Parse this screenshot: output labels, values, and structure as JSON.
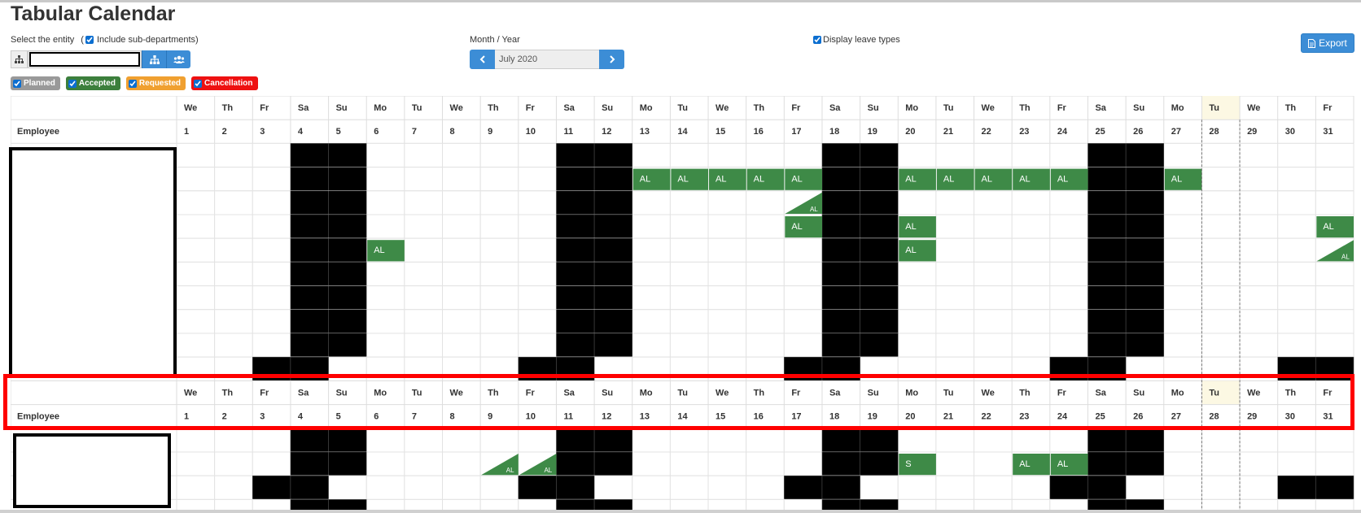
{
  "page": {
    "title": "Tabular Calendar"
  },
  "filters": {
    "entity_label": "Select the entity",
    "include_open_paren": "(",
    "include_sub_label": "Include sub-departments)",
    "include_sub_checked": true,
    "entity_value": "",
    "month_label": "Month / Year",
    "month_value": "July 2020",
    "display_leave_types_label": "Display leave types",
    "display_leave_types_checked": true,
    "export_label": "Export"
  },
  "legend": [
    {
      "label": "Planned",
      "color": "#999999"
    },
    {
      "label": "Accepted",
      "color": "#3c7f3c"
    },
    {
      "label": "Requested",
      "color": "#f0a030"
    },
    {
      "label": "Cancellation",
      "color": "#ee1111"
    }
  ],
  "colors": {
    "leave": "#3e8a47",
    "weekend": "#000000",
    "today_header": "#fcf8e3",
    "highlight": "#ff0000"
  },
  "calendar": {
    "employee_header": "Employee",
    "today_day": 28,
    "days": [
      {
        "d": 1,
        "w": "We"
      },
      {
        "d": 2,
        "w": "Th"
      },
      {
        "d": 3,
        "w": "Fr"
      },
      {
        "d": 4,
        "w": "Sa"
      },
      {
        "d": 5,
        "w": "Su"
      },
      {
        "d": 6,
        "w": "Mo"
      },
      {
        "d": 7,
        "w": "Tu"
      },
      {
        "d": 8,
        "w": "We"
      },
      {
        "d": 9,
        "w": "Th"
      },
      {
        "d": 10,
        "w": "Fr"
      },
      {
        "d": 11,
        "w": "Sa"
      },
      {
        "d": 12,
        "w": "Su"
      },
      {
        "d": 13,
        "w": "Mo"
      },
      {
        "d": 14,
        "w": "Tu"
      },
      {
        "d": 15,
        "w": "We"
      },
      {
        "d": 16,
        "w": "Th"
      },
      {
        "d": 17,
        "w": "Fr"
      },
      {
        "d": 18,
        "w": "Sa"
      },
      {
        "d": 19,
        "w": "Su"
      },
      {
        "d": 20,
        "w": "Mo"
      },
      {
        "d": 21,
        "w": "Tu"
      },
      {
        "d": 22,
        "w": "We"
      },
      {
        "d": 23,
        "w": "Th"
      },
      {
        "d": 24,
        "w": "Fr"
      },
      {
        "d": 25,
        "w": "Sa"
      },
      {
        "d": 26,
        "w": "Su"
      },
      {
        "d": 27,
        "w": "Mo"
      },
      {
        "d": 28,
        "w": "Tu"
      },
      {
        "d": 29,
        "w": "We"
      },
      {
        "d": 30,
        "w": "Th"
      },
      {
        "d": 31,
        "w": "Fr"
      }
    ],
    "groups": [
      {
        "employee_name": "",
        "rows": [
          {
            "blocked": [
              4,
              5,
              11,
              12,
              18,
              19,
              25,
              26
            ],
            "leaves": []
          },
          {
            "blocked": [
              4,
              5,
              11,
              12,
              18,
              19,
              25,
              26
            ],
            "leaves": [
              {
                "day": 13,
                "code": "AL"
              },
              {
                "day": 14,
                "code": "AL"
              },
              {
                "day": 15,
                "code": "AL"
              },
              {
                "day": 16,
                "code": "AL"
              },
              {
                "day": 17,
                "code": "AL"
              },
              {
                "day": 20,
                "code": "AL"
              },
              {
                "day": 21,
                "code": "AL"
              },
              {
                "day": 22,
                "code": "AL"
              },
              {
                "day": 23,
                "code": "AL"
              },
              {
                "day": 24,
                "code": "AL"
              },
              {
                "day": 27,
                "code": "AL"
              }
            ]
          },
          {
            "blocked": [
              4,
              5,
              11,
              12,
              18,
              19,
              25,
              26
            ],
            "leaves": [
              {
                "day": 17,
                "code": "AL",
                "half": true
              }
            ]
          },
          {
            "blocked": [
              4,
              5,
              11,
              12,
              18,
              19,
              25,
              26
            ],
            "leaves": [
              {
                "day": 17,
                "code": "AL"
              },
              {
                "day": 20,
                "code": "AL"
              },
              {
                "day": 31,
                "code": "AL"
              }
            ]
          },
          {
            "blocked": [
              4,
              5,
              11,
              12,
              18,
              19,
              25,
              26
            ],
            "leaves": [
              {
                "day": 6,
                "code": "AL"
              },
              {
                "day": 20,
                "code": "AL"
              },
              {
                "day": 31,
                "code": "AL",
                "half": true
              }
            ]
          },
          {
            "blocked": [
              4,
              5,
              11,
              12,
              18,
              19,
              25,
              26
            ],
            "leaves": []
          },
          {
            "blocked": [
              4,
              5,
              11,
              12,
              18,
              19,
              25,
              26
            ],
            "leaves": []
          },
          {
            "blocked": [
              4,
              5,
              11,
              12,
              18,
              19,
              25,
              26
            ],
            "leaves": []
          },
          {
            "blocked": [
              4,
              5,
              11,
              12,
              18,
              19,
              25,
              26
            ],
            "leaves": []
          },
          {
            "blocked": [
              3,
              4,
              10,
              11,
              17,
              18,
              24,
              25,
              30,
              31
            ],
            "leaves": []
          }
        ]
      },
      {
        "employee_name": "",
        "rows": [
          {
            "blocked": [
              4,
              5,
              11,
              12,
              18,
              19,
              25,
              26
            ],
            "leaves": []
          },
          {
            "blocked": [
              4,
              5,
              11,
              12,
              18,
              19,
              25,
              26
            ],
            "leaves": [
              {
                "day": 9,
                "code": "AL",
                "half": true
              },
              {
                "day": 10,
                "code": "AL",
                "half": true
              },
              {
                "day": 20,
                "code": "S"
              },
              {
                "day": 23,
                "code": "AL"
              },
              {
                "day": 24,
                "code": "AL"
              }
            ]
          },
          {
            "blocked": [
              3,
              4,
              10,
              11,
              17,
              18,
              24,
              25,
              30,
              31
            ],
            "leaves": []
          },
          {
            "blocked": [
              4,
              5,
              11,
              12,
              18,
              19,
              25,
              26
            ],
            "leaves": []
          }
        ]
      }
    ]
  }
}
